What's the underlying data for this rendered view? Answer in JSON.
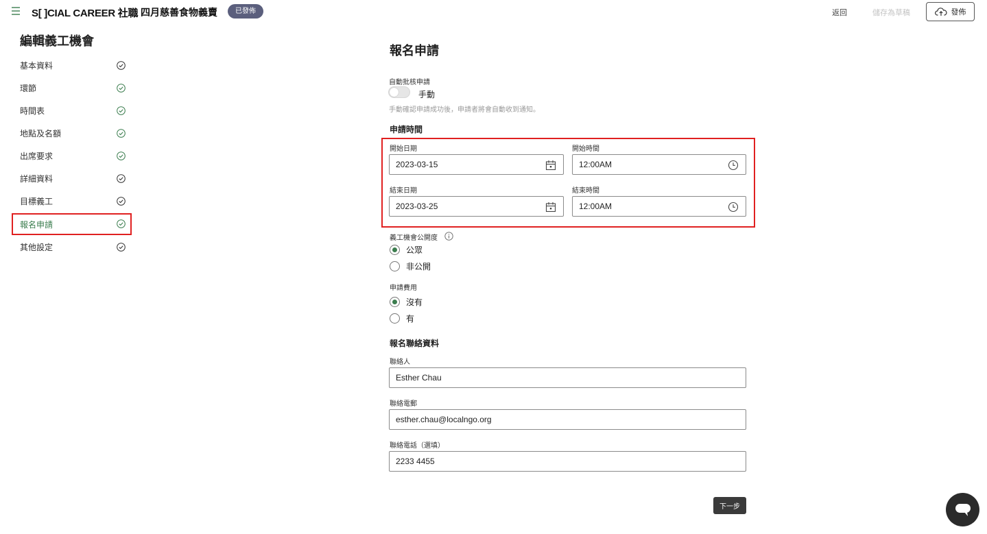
{
  "header": {
    "brand": "S[ ]CIAL CAREER 社職",
    "page_name": "四月慈善食物義賣",
    "status_badge": "已發佈",
    "back_label": "返回",
    "save_draft_label": "儲存為草稿",
    "publish_label": "發佈"
  },
  "sidebar": {
    "title": "編輯義工機會",
    "items": [
      {
        "label": "基本資料",
        "check_color": "#333333"
      },
      {
        "label": "環節",
        "check_color": "#3b7d4e"
      },
      {
        "label": "時間表",
        "check_color": "#3b7d4e"
      },
      {
        "label": "地點及名額",
        "check_color": "#3b7d4e"
      },
      {
        "label": "出席要求",
        "check_color": "#3b7d4e"
      },
      {
        "label": "詳細資料",
        "check_color": "#333333"
      },
      {
        "label": "目標義工",
        "check_color": "#333333"
      },
      {
        "label": "報名申請",
        "check_color": "#3b7d4e",
        "active": true
      },
      {
        "label": "其他設定",
        "check_color": "#333333"
      }
    ]
  },
  "form": {
    "title": "報名申請",
    "auto_approve": {
      "label": "自動批核申請",
      "toggle_label": "手動",
      "enabled": false,
      "hint": "手動確認申請成功後，申請者將會自動收到通知。"
    },
    "application_period": {
      "heading": "申請時間",
      "start_date_label": "開始日期",
      "start_date": "2023-03-15",
      "start_time_label": "開始時間",
      "start_time": "12:00AM",
      "end_date_label": "結束日期",
      "end_date": "2023-03-25",
      "end_time_label": "結束時間",
      "end_time": "12:00AM"
    },
    "visibility": {
      "label": "義工機會公開度",
      "options": [
        "公眾",
        "非公開"
      ],
      "selected": "公眾"
    },
    "fee": {
      "label": "申請費用",
      "options": [
        "沒有",
        "有"
      ],
      "selected": "沒有"
    },
    "contact": {
      "heading": "報名聯絡資料",
      "person_label": "聯絡人",
      "person": "Esther Chau",
      "email_label": "聯絡電郵",
      "email": "esther.chau@localngo.org",
      "phone_label": "聯絡電話（選填）",
      "phone": "2233 4455"
    },
    "next_label": "下一步"
  },
  "colors": {
    "accent_green": "#3b7d4e",
    "highlight_red": "#e02020",
    "badge": "#5b5f7d"
  }
}
